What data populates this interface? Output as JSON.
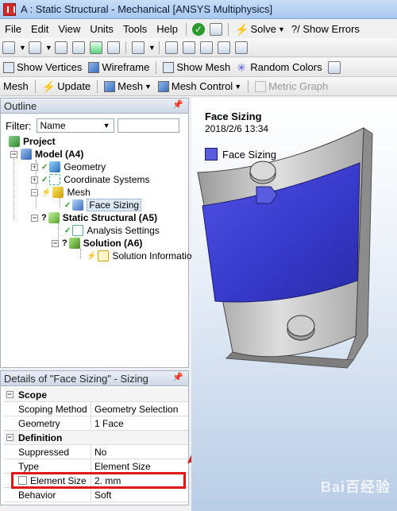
{
  "window": {
    "title": "A : Static Structural - Mechanical [ANSYS Multiphysics]"
  },
  "menu": {
    "items": [
      "File",
      "Edit",
      "View",
      "Units",
      "Tools",
      "Help"
    ],
    "solve_label": "Solve",
    "show_errors_label": "?/ Show Errors"
  },
  "toolbar2": {
    "show_vertices": "Show Vertices",
    "wireframe": "Wireframe",
    "show_mesh": "Show Mesh",
    "random_colors": "Random Colors"
  },
  "toolbar3": {
    "mesh_label": "Mesh",
    "update_label": "Update",
    "mesh_menu_label": "Mesh",
    "mesh_control_label": "Mesh Control",
    "metric_graph_label": "Metric Graph"
  },
  "outline": {
    "header": "Outline",
    "filter_label": "Filter:",
    "filter_value": "Name",
    "tree": {
      "project": "Project",
      "model": "Model (A4)",
      "geometry": "Geometry",
      "coordinate_systems": "Coordinate Systems",
      "mesh": "Mesh",
      "face_sizing": "Face Sizing",
      "static_structural": "Static Structural (A5)",
      "analysis_settings": "Analysis Settings",
      "solution": "Solution (A6)",
      "solution_information": "Solution Information"
    }
  },
  "details": {
    "header": "Details of \"Face Sizing\" - Sizing",
    "scope_section": "Scope",
    "scoping_method_key": "Scoping Method",
    "scoping_method_val": "Geometry Selection",
    "geometry_key": "Geometry",
    "geometry_val": "1 Face",
    "definition_section": "Definition",
    "suppressed_key": "Suppressed",
    "suppressed_val": "No",
    "type_key": "Type",
    "type_val": "Element Size",
    "element_size_key": "Element Size",
    "element_size_val": "2. mm",
    "behavior_key": "Behavior",
    "behavior_val": "Soft"
  },
  "viewport": {
    "title": "Face Sizing",
    "date": "2018/2/6 13:34",
    "legend_label": "Face Sizing",
    "legend_color": "#5a5ce0",
    "watermark": "Bai百经验"
  },
  "colors": {
    "highlight": "#e0171a",
    "face": "#3a3ad6",
    "body": "#c8c8c8"
  }
}
